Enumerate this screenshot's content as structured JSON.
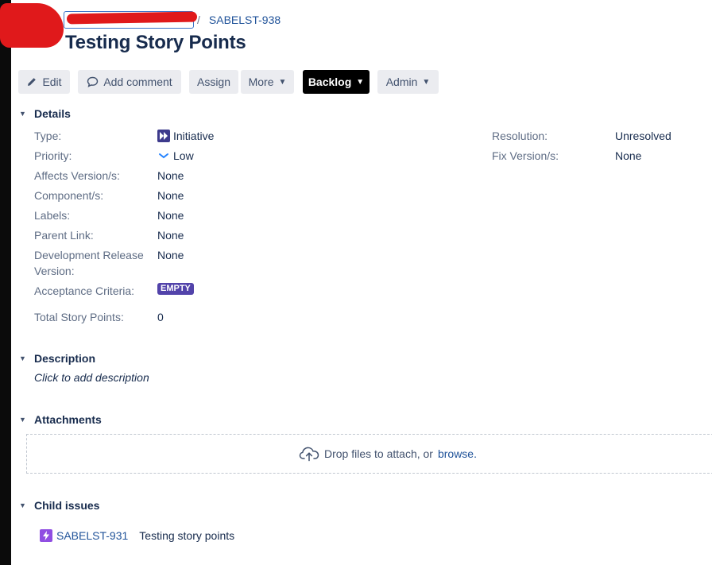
{
  "breadcrumb": {
    "separator": "/",
    "issue_key": "SABELST-938"
  },
  "issue": {
    "title": "Testing Story Points"
  },
  "toolbar": {
    "edit_label": "Edit",
    "add_comment_label": "Add comment",
    "assign_label": "Assign",
    "more_label": "More",
    "backlog_label": "Backlog",
    "admin_label": "Admin"
  },
  "details": {
    "heading": "Details",
    "fields": [
      {
        "label": "Type:",
        "value": "Initiative",
        "icon": "initiative-icon"
      },
      {
        "label": "Priority:",
        "value": "Low",
        "icon": "priority-low-icon"
      },
      {
        "label": "Affects Version/s:",
        "value": "None"
      },
      {
        "label": "Component/s:",
        "value": "None"
      },
      {
        "label": "Labels:",
        "value": "None"
      },
      {
        "label": "Parent Link:",
        "value": "None"
      },
      {
        "label": "Development Release",
        "label_cont": "Version:",
        "value": "None"
      },
      {
        "label": "Acceptance Criteria:",
        "value": "EMPTY"
      },
      {
        "label": "Total Story Points:",
        "value": "0"
      }
    ],
    "right_fields": [
      {
        "label": "Resolution:",
        "value": "Unresolved"
      },
      {
        "label": "Fix Version/s:",
        "value": "None"
      }
    ]
  },
  "description": {
    "heading": "Description",
    "placeholder": "Click to add description"
  },
  "attachments": {
    "heading": "Attachments",
    "drop_text": "Drop files to attach, or",
    "browse_link": "browse."
  },
  "child_issues": {
    "heading": "Child issues",
    "items": [
      {
        "key": "SABELST-931",
        "summary": "Testing story points",
        "icon": "epic-icon"
      }
    ]
  },
  "colors": {
    "link": "#1f5299",
    "lozenge": "#5243aa",
    "dark_button": "#000000",
    "child_icon": "#904ee2",
    "redaction": "#e0191b"
  }
}
